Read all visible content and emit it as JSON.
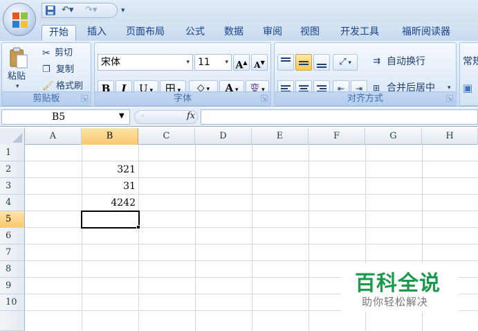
{
  "qat": {
    "save_icon": "save-icon",
    "undo_icon": "undo-icon",
    "redo_icon": "redo-icon",
    "customize_icon": "customize-icon"
  },
  "tabs": [
    {
      "label": "开始",
      "active": true
    },
    {
      "label": "插入"
    },
    {
      "label": "页面布局"
    },
    {
      "label": "公式"
    },
    {
      "label": "数据"
    },
    {
      "label": "审阅"
    },
    {
      "label": "视图"
    },
    {
      "label": "开发工具"
    },
    {
      "label": "福昕阅读器"
    }
  ],
  "clipboard": {
    "paste_label": "粘贴",
    "cut_label": "剪切",
    "copy_label": "复制",
    "format_painter_label": "格式刷",
    "group_label": "剪贴板"
  },
  "font": {
    "font_name": "宋体",
    "font_size": "11",
    "grow_label": "A",
    "shrink_label": "A",
    "bold_label": "B",
    "italic_label": "I",
    "underline_label": "U",
    "border_glyph": "田",
    "fill_glyph": "◇",
    "font_color_label": "A",
    "phonetic_glyph": "变",
    "group_label": "字体"
  },
  "alignment": {
    "wrap_label": "自动换行",
    "merge_label": "合并后居中",
    "group_label": "对齐方式"
  },
  "number": {
    "format_label": "常规"
  },
  "formula_bar": {
    "name_box": "B5",
    "fx_label": "fx",
    "formula": ""
  },
  "sheet": {
    "columns": [
      "A",
      "B",
      "C",
      "D",
      "E",
      "F",
      "G",
      "H"
    ],
    "rows": [
      "1",
      "2",
      "3",
      "4",
      "5",
      "6",
      "7",
      "8",
      "9",
      "10"
    ],
    "selected_column": "B",
    "selected_row": "5",
    "cells": [
      {
        "ref": "B2",
        "value": "321"
      },
      {
        "ref": "B3",
        "value": "31"
      },
      {
        "ref": "B4",
        "value": "4242"
      }
    ]
  },
  "watermark": {
    "title": "百科全说",
    "subtitle": "助你轻松解决"
  },
  "colors": {
    "selection_highlight": "#f9c770",
    "watermark_green": "#1a9a4c",
    "ribbon_blue": "#dbe7f6"
  }
}
